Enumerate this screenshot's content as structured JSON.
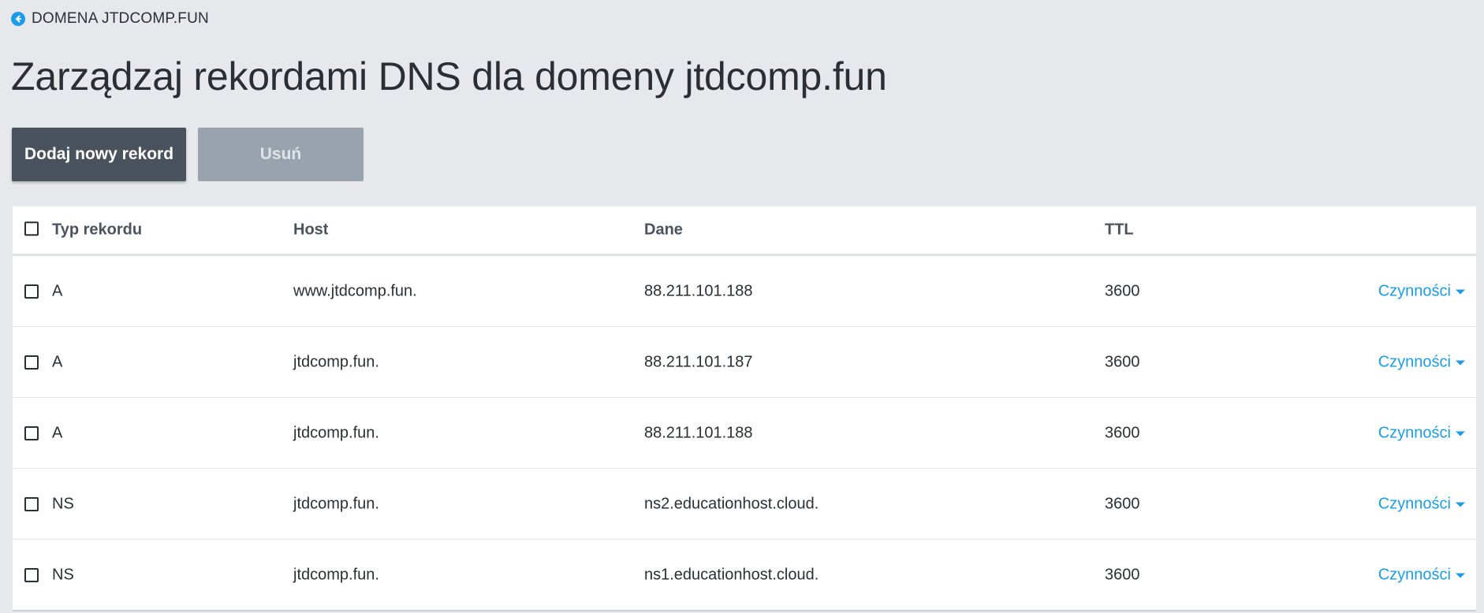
{
  "breadcrumb": {
    "label": "DOMENA JTDCOMP.FUN",
    "icon": "arrow-left-circle-icon"
  },
  "page": {
    "title": "Zarządzaj rekordami DNS dla domeny jtdcomp.fun"
  },
  "toolbar": {
    "add_label": "Dodaj nowy rekord",
    "delete_label": "Usuń"
  },
  "table": {
    "headers": {
      "type": "Typ rekordu",
      "host": "Host",
      "data": "Dane",
      "ttl": "TTL"
    },
    "actions_label": "Czynności",
    "rows": [
      {
        "type": "A",
        "host": "www.jtdcomp.fun.",
        "data": "88.211.101.188",
        "ttl": "3600"
      },
      {
        "type": "A",
        "host": "jtdcomp.fun.",
        "data": "88.211.101.187",
        "ttl": "3600"
      },
      {
        "type": "A",
        "host": "jtdcomp.fun.",
        "data": "88.211.101.188",
        "ttl": "3600"
      },
      {
        "type": "NS",
        "host": "jtdcomp.fun.",
        "data": "ns2.educationhost.cloud.",
        "ttl": "3600"
      },
      {
        "type": "NS",
        "host": "jtdcomp.fun.",
        "data": "ns1.educationhost.cloud.",
        "ttl": "3600"
      }
    ]
  },
  "colors": {
    "accent": "#1c9ce6",
    "primary_button": "#4a535d",
    "disabled_button": "#98a3ad",
    "background": "#e6e8eb"
  }
}
